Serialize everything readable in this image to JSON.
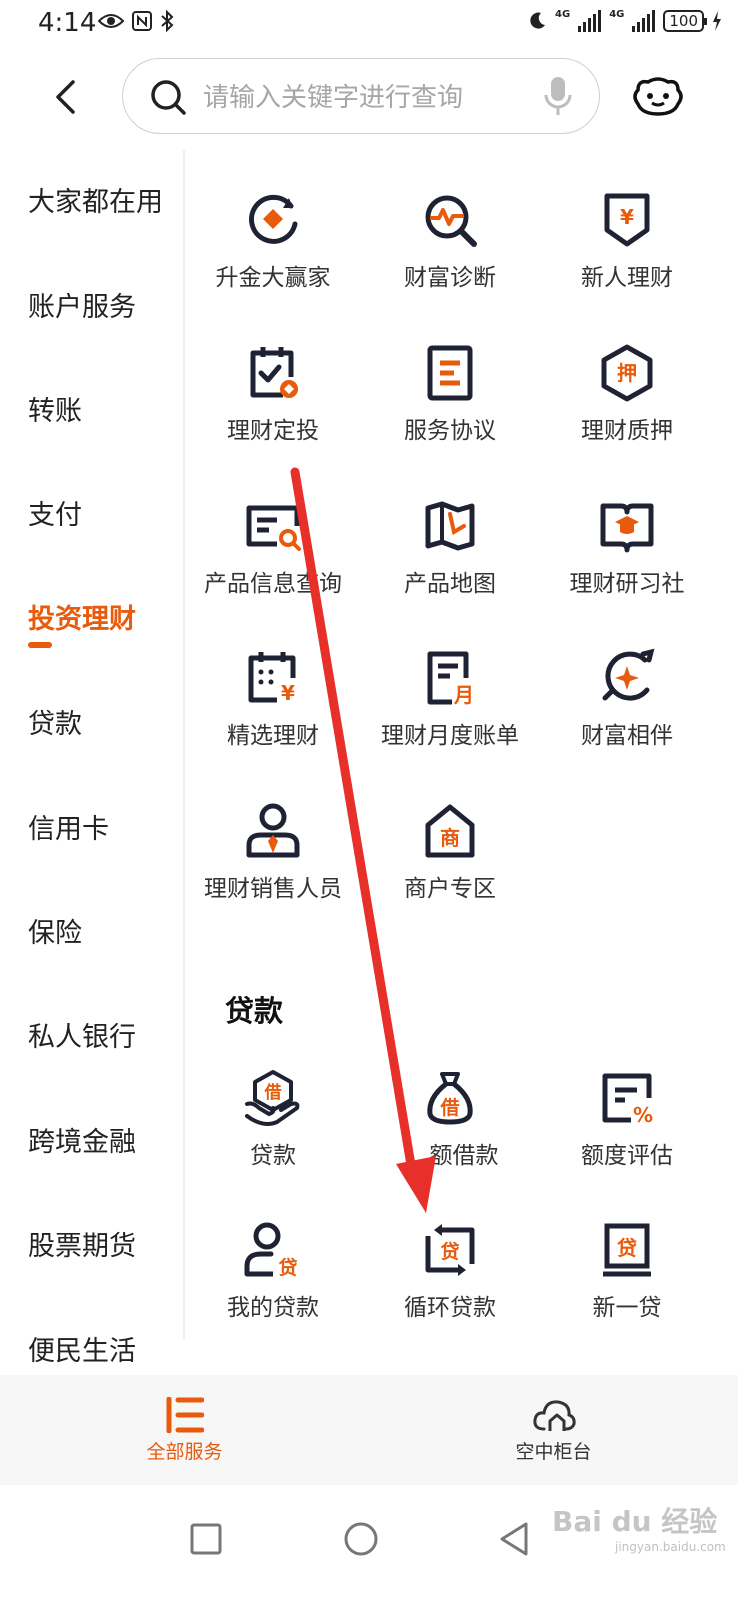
{
  "status_bar": {
    "time": "4:14",
    "network_1": "4G",
    "network_2": "4G",
    "battery": "100"
  },
  "search": {
    "placeholder": "请输入关键字进行查询"
  },
  "sidebar": {
    "items": [
      {
        "label": "大家都在用"
      },
      {
        "label": "账户服务"
      },
      {
        "label": "转账"
      },
      {
        "label": "支付"
      },
      {
        "label": "投资理财"
      },
      {
        "label": "贷款"
      },
      {
        "label": "信用卡"
      },
      {
        "label": "保险"
      },
      {
        "label": "私人银行"
      },
      {
        "label": "跨境金融"
      },
      {
        "label": "股票期货"
      },
      {
        "label": "便民生活"
      }
    ],
    "active": "投资理财"
  },
  "invest": {
    "items": [
      {
        "label": "升金大赢家",
        "icon": "diamond-refresh-icon"
      },
      {
        "label": "财富诊断",
        "icon": "wealth-diagnosis-icon"
      },
      {
        "label": "新人理财",
        "icon": "yuan-shield-icon"
      },
      {
        "label": "理财定投",
        "icon": "calendar-check-icon"
      },
      {
        "label": "服务协议",
        "icon": "document-icon"
      },
      {
        "label": "理财质押",
        "icon": "pledge-hexagon-icon"
      },
      {
        "label": "产品信息查询",
        "icon": "card-search-icon"
      },
      {
        "label": "产品地图",
        "icon": "map-icon"
      },
      {
        "label": "理财研习社",
        "icon": "graduation-book-icon"
      },
      {
        "label": "精选理财",
        "icon": "calendar-yuan-icon"
      },
      {
        "label": "理财月度账单",
        "icon": "monthly-bill-icon"
      },
      {
        "label": "财富相伴",
        "icon": "star-compass-icon"
      },
      {
        "label": "理财销售人员",
        "icon": "salesperson-icon"
      },
      {
        "label": "商户专区",
        "icon": "merchant-house-icon"
      }
    ],
    "glyphs": {
      "yuan": "¥",
      "pledge": "押",
      "month": "月",
      "merchant": "商"
    }
  },
  "loan": {
    "title": "贷款",
    "items": [
      {
        "label": "贷款",
        "icon": "loan-hand-icon"
      },
      {
        "label": "额借款",
        "icon": "money-bag-icon"
      },
      {
        "label": "额度评估",
        "icon": "quota-percent-icon"
      },
      {
        "label": "我的贷款",
        "icon": "user-loan-icon"
      },
      {
        "label": "循环贷款",
        "icon": "cycle-loan-icon"
      },
      {
        "label": "新一贷",
        "icon": "new-loan-icon"
      }
    ],
    "glyphs": {
      "borrow": "借",
      "loan": "贷",
      "percent": "%"
    }
  },
  "tabs": [
    {
      "label": "全部服务",
      "icon": "all-services-icon"
    },
    {
      "label": "空中柜台",
      "icon": "cloud-counter-icon"
    }
  ],
  "watermark": {
    "text": "Bai du 经验",
    "sub": "jingyan.baidu.com"
  },
  "colors": {
    "accent": "#e85a0c",
    "icon_dark": "#1f2233",
    "arrow": "#e8302a"
  }
}
